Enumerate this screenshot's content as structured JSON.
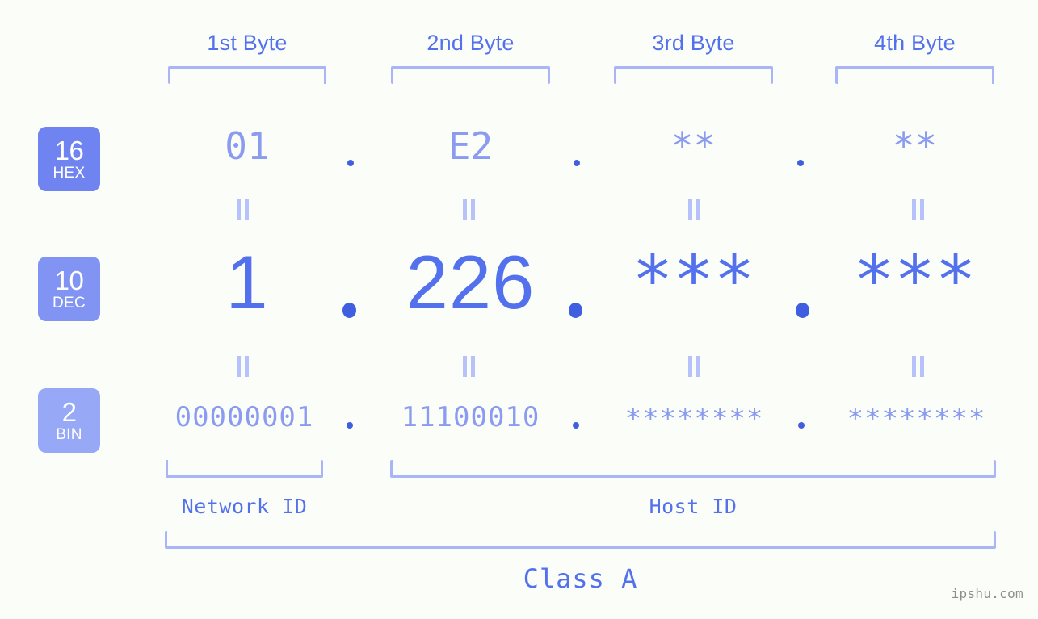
{
  "page": {
    "background_color": "#fbfdf9",
    "accent_color": "#5371ec",
    "muted_accent_color": "#8a9bf0",
    "bracket_color": "#aab4f8",
    "watermark": "ipshu.com"
  },
  "byte_headers": [
    {
      "label": "1st Byte"
    },
    {
      "label": "2nd Byte"
    },
    {
      "label": "3rd Byte"
    },
    {
      "label": "4th Byte"
    }
  ],
  "bases": [
    {
      "number": "16",
      "abbr": "HEX",
      "color": "#6f84f0"
    },
    {
      "number": "10",
      "abbr": "DEC",
      "color": "#8194f3"
    },
    {
      "number": "2",
      "abbr": "BIN",
      "color": "#96a8f6"
    }
  ],
  "rows": {
    "hex": {
      "values": [
        "01",
        "E2",
        "**",
        "**"
      ]
    },
    "dec": {
      "values": [
        "1",
        "226",
        "***",
        "***"
      ],
      "masked": [
        false,
        false,
        true,
        true
      ]
    },
    "bin": {
      "values": [
        "00000001",
        "11100010",
        "********",
        "********"
      ]
    }
  },
  "separators": {
    "dot": "."
  },
  "equals_marks": {
    "symbol": "||"
  },
  "id_spans": [
    {
      "label": "Network ID"
    },
    {
      "label": "Host ID"
    }
  ],
  "class_span": {
    "label": "Class A"
  }
}
